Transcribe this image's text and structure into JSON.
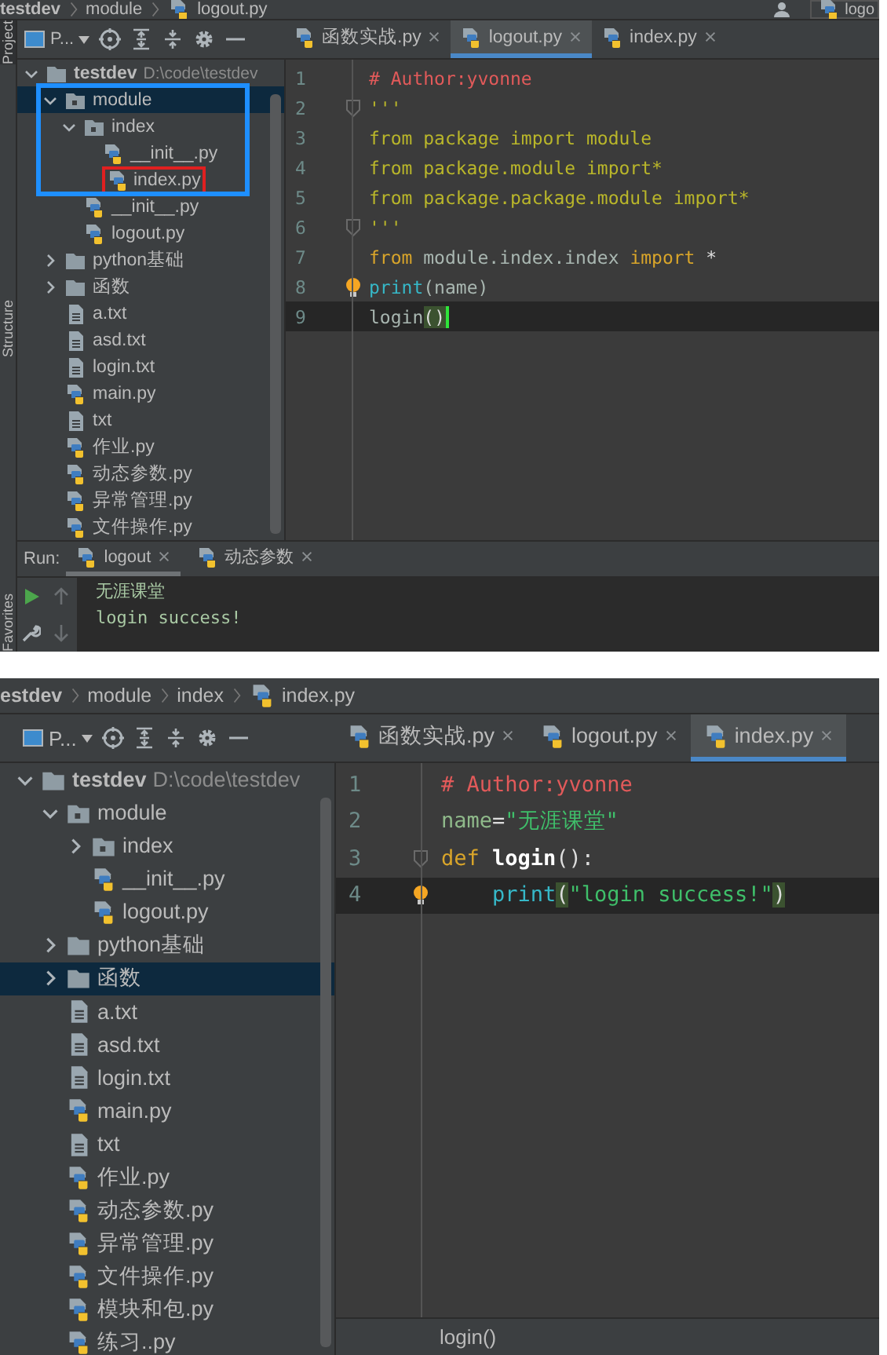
{
  "screens": [
    {
      "breadcrumb": [
        "testdev",
        "module",
        "logout.py"
      ],
      "run_config": "logo",
      "side_tabs": [
        {
          "label": "Project",
          "selected": true
        },
        {
          "label": "Structure",
          "selected": false
        },
        {
          "label": "Favorites",
          "selected": false
        }
      ],
      "view_selector": "P...",
      "tabs": [
        {
          "label": "函数实战.py",
          "selected": false
        },
        {
          "label": "logout.py",
          "selected": true
        },
        {
          "label": "index.py",
          "selected": false
        }
      ],
      "tree": [
        {
          "label": "testdev",
          "kind": "folder",
          "note": "D:\\code\\testdev",
          "expanded": true,
          "selected": false,
          "framed": false,
          "children": [
            {
              "label": "module",
              "kind": "package",
              "expanded": true,
              "selected": true,
              "framed": true,
              "children": [
                {
                  "label": "index",
                  "kind": "package",
                  "expanded": true,
                  "selected": false,
                  "framed": true,
                  "children": [
                    {
                      "label": "__init__.py",
                      "kind": "python",
                      "selected": false,
                      "framed": true
                    },
                    {
                      "label": "index.py",
                      "kind": "python",
                      "selected": false,
                      "framed": true,
                      "boxed": true
                    }
                  ]
                },
                {
                  "label": "__init__.py",
                  "kind": "python",
                  "selected": false,
                  "framed": false
                },
                {
                  "label": "logout.py",
                  "kind": "python",
                  "selected": false,
                  "framed": false
                }
              ]
            },
            {
              "label": "python基础",
              "kind": "folder",
              "expanded": false,
              "selected": false,
              "framed": false
            },
            {
              "label": "函数",
              "kind": "folder",
              "expanded": false,
              "selected": false,
              "framed": false
            },
            {
              "label": "a.txt",
              "kind": "text",
              "selected": false,
              "framed": false
            },
            {
              "label": "asd.txt",
              "kind": "text",
              "selected": false,
              "framed": false
            },
            {
              "label": "login.txt",
              "kind": "text",
              "selected": false,
              "framed": false
            },
            {
              "label": "main.py",
              "kind": "python",
              "selected": false,
              "framed": false
            },
            {
              "label": "txt",
              "kind": "text",
              "selected": false,
              "framed": false
            },
            {
              "label": "作业.py",
              "kind": "python",
              "selected": false,
              "framed": false
            },
            {
              "label": "动态参数.py",
              "kind": "python",
              "selected": false,
              "framed": false
            },
            {
              "label": "异常管理.py",
              "kind": "python",
              "selected": false,
              "framed": false
            },
            {
              "label": "文件操作.py",
              "kind": "python",
              "selected": false,
              "framed": false
            }
          ]
        }
      ],
      "editor": {
        "lines": [
          {
            "number": "1",
            "kind": "plain",
            "current": false,
            "tokens": [
              {
                "text": "# Author:yvonne",
                "kind": "comment"
              }
            ]
          },
          {
            "number": "2",
            "kind": "fold",
            "current": false,
            "tokens": [
              {
                "text": "'''",
                "kind": "docstring"
              }
            ]
          },
          {
            "number": "3",
            "kind": "plain",
            "current": false,
            "tokens": [
              {
                "text": "from package import module",
                "kind": "docstring"
              }
            ]
          },
          {
            "number": "4",
            "kind": "plain",
            "current": false,
            "tokens": [
              {
                "text": "from package.module import*",
                "kind": "docstring"
              }
            ]
          },
          {
            "number": "5",
            "kind": "plain",
            "current": false,
            "tokens": [
              {
                "text": "from package.package.module import*",
                "kind": "docstring"
              }
            ]
          },
          {
            "number": "6",
            "kind": "fold",
            "current": false,
            "tokens": [
              {
                "text": "'''",
                "kind": "docstring"
              }
            ]
          },
          {
            "number": "7",
            "kind": "plain",
            "current": false,
            "tokens": [
              {
                "text": "from",
                "kind": "keyword"
              },
              {
                "text": " module.index.index ",
                "kind": "plain"
              },
              {
                "text": "import",
                "kind": "keyword"
              },
              {
                "text": " *",
                "kind": "punct"
              }
            ]
          },
          {
            "number": "8",
            "kind": "bulb",
            "current": false,
            "tokens": [
              {
                "text": "print",
                "kind": "builtin"
              },
              {
                "text": "(name)",
                "kind": "plain"
              }
            ]
          },
          {
            "number": "9",
            "kind": "plain",
            "current": true,
            "caret": true,
            "tokens": [
              {
                "text": "login",
                "kind": "plain"
              },
              {
                "text": "(",
                "kind": "brace"
              },
              {
                "text": ")",
                "kind": "brace"
              }
            ]
          }
        ]
      },
      "run_panel": {
        "label": "Run:",
        "tabs": [
          {
            "label": "logout",
            "selected": true
          },
          {
            "label": "动态参数",
            "selected": false
          }
        ],
        "output": [
          "无涯课堂",
          "login success!"
        ]
      }
    },
    {
      "breadcrumb": [
        "estdev",
        "module",
        "index",
        "index.py"
      ],
      "view_selector": "P...",
      "tabs": [
        {
          "label": "函数实战.py",
          "selected": false
        },
        {
          "label": "logout.py",
          "selected": false
        },
        {
          "label": "index.py",
          "selected": true
        }
      ],
      "tree": [
        {
          "label": "testdev",
          "kind": "folder",
          "note": "D:\\code\\testdev",
          "expanded": true,
          "selected": false,
          "children": [
            {
              "label": "module",
              "kind": "package",
              "expanded": true,
              "selected": false,
              "children": [
                {
                  "label": "index",
                  "kind": "package",
                  "expanded": false,
                  "selected": false
                },
                {
                  "label": "__init__.py",
                  "kind": "python",
                  "selected": false
                },
                {
                  "label": "logout.py",
                  "kind": "python",
                  "selected": false
                }
              ]
            },
            {
              "label": "python基础",
              "kind": "folder",
              "expanded": false,
              "selected": false
            },
            {
              "label": "函数",
              "kind": "folder",
              "expanded": false,
              "selected": true
            },
            {
              "label": "a.txt",
              "kind": "text",
              "selected": false
            },
            {
              "label": "asd.txt",
              "kind": "text",
              "selected": false
            },
            {
              "label": "login.txt",
              "kind": "text",
              "selected": false
            },
            {
              "label": "main.py",
              "kind": "python",
              "selected": false
            },
            {
              "label": "txt",
              "kind": "text",
              "selected": false
            },
            {
              "label": "作业.py",
              "kind": "python",
              "selected": false
            },
            {
              "label": "动态参数.py",
              "kind": "python",
              "selected": false
            },
            {
              "label": "异常管理.py",
              "kind": "python",
              "selected": false
            },
            {
              "label": "文件操作.py",
              "kind": "python",
              "selected": false
            },
            {
              "label": "模块和包.py",
              "kind": "python",
              "selected": false
            },
            {
              "label": "练习..py",
              "kind": "python",
              "selected": false
            }
          ]
        }
      ],
      "editor": {
        "lines": [
          {
            "number": "1",
            "kind": "plain",
            "indented": false,
            "current": false,
            "tokens": [
              {
                "text": "# Author:yvonne",
                "kind": "comment"
              }
            ]
          },
          {
            "number": "2",
            "kind": "plain",
            "indented": false,
            "current": false,
            "tokens": [
              {
                "text": "name",
                "kind": "name"
              },
              {
                "text": "=",
                "kind": "punct"
              },
              {
                "text": "\"无涯课堂\"",
                "kind": "string"
              }
            ]
          },
          {
            "number": "3",
            "kind": "fold",
            "indented": false,
            "current": false,
            "tokens": [
              {
                "text": "def",
                "kind": "keyword"
              },
              {
                "text": "login",
                "kind": "funcname"
              },
              {
                "text": "():",
                "kind": "punct"
              }
            ]
          },
          {
            "number": "4",
            "kind": "bulb",
            "indented": true,
            "current": true,
            "tokens": [
              {
                "text": "print",
                "kind": "builtin"
              },
              {
                "text": "(",
                "kind": "brace"
              },
              {
                "text": "\"login success!\"",
                "kind": "string"
              },
              {
                "text": ")",
                "kind": "brace"
              }
            ]
          }
        ]
      },
      "status": "login()"
    }
  ]
}
